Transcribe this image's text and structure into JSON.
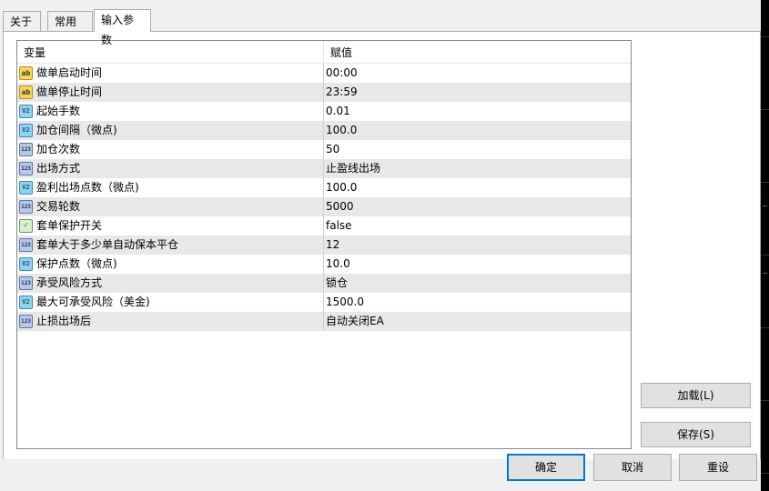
{
  "tabs": [
    {
      "label": "关于"
    },
    {
      "label": "常用"
    },
    {
      "label": "输入参数"
    }
  ],
  "table": {
    "headers": {
      "variable": "变量",
      "value": "赋值"
    },
    "rows": [
      {
        "icon": "ab",
        "name": "做单启动时间",
        "value": "00:00"
      },
      {
        "icon": "ab",
        "name": "做单停止时间",
        "value": "23:59"
      },
      {
        "icon": "v2",
        "name": "起始手数",
        "value": "0.01"
      },
      {
        "icon": "v2",
        "name": "加仓间隔（微点)",
        "value": "100.0"
      },
      {
        "icon": "123",
        "name": "加仓次数",
        "value": "50"
      },
      {
        "icon": "123",
        "name": "出场方式",
        "value": "止盈线出场"
      },
      {
        "icon": "v2",
        "name": "盈利出场点数（微点)",
        "value": "100.0"
      },
      {
        "icon": "123",
        "name": "交易轮数",
        "value": "5000"
      },
      {
        "icon": "bool",
        "name": "套单保护开关",
        "value": "false"
      },
      {
        "icon": "123",
        "name": "套单大于多少单自动保本平仓",
        "value": "12"
      },
      {
        "icon": "v2",
        "name": "保护点数（微点)",
        "value": "10.0"
      },
      {
        "icon": "123",
        "name": "承受风险方式",
        "value": "锁仓"
      },
      {
        "icon": "v2",
        "name": "最大可承受风险（美金)",
        "value": "1500.0"
      },
      {
        "icon": "123",
        "name": "止损出场后",
        "value": "自动关闭EA"
      }
    ]
  },
  "buttons": {
    "load": "加载(L)",
    "save": "保存(S)",
    "ok": "确定",
    "cancel": "取消",
    "reset": "重设"
  },
  "icon_text": {
    "ab": "ab",
    "v2": "V2",
    "123": "123",
    "bool": "✓"
  },
  "colors": {
    "accent": "#0078d7",
    "alt_row": "#e8e8e8",
    "border": "#adadad"
  }
}
